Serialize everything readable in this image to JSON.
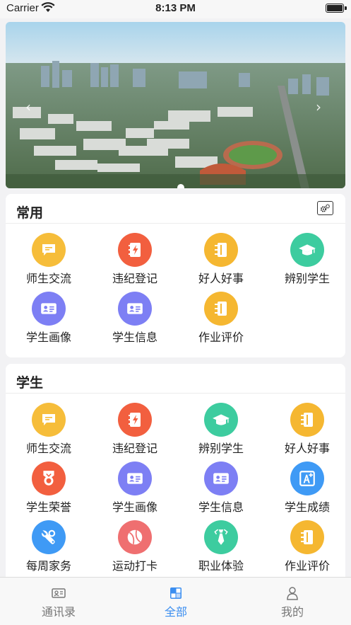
{
  "status_bar": {
    "carrier": "Carrier",
    "time": "8:13 PM"
  },
  "banner": {
    "slide_count": 1,
    "active_slide": 1
  },
  "common": {
    "title": "常用",
    "items": [
      {
        "label": "师生交流",
        "icon": "chat-icon",
        "color": "#f6bd3a"
      },
      {
        "label": "违纪登记",
        "icon": "lightning-notebook-icon",
        "color": "#f25f3f"
      },
      {
        "label": "好人好事",
        "icon": "notebook-icon",
        "color": "#f5b731"
      },
      {
        "label": "辨别学生",
        "icon": "graduation-cap-icon",
        "color": "#3dcc9f"
      },
      {
        "label": "学生画像",
        "icon": "id-card-icon",
        "color": "#7d7ff4"
      },
      {
        "label": "学生信息",
        "icon": "id-card-icon",
        "color": "#7d7ff4"
      },
      {
        "label": "作业评价",
        "icon": "notebook-icon",
        "color": "#f5b731"
      }
    ]
  },
  "student": {
    "title": "学生",
    "items": [
      {
        "label": "师生交流",
        "icon": "chat-icon",
        "color": "#f6bd3a"
      },
      {
        "label": "违纪登记",
        "icon": "lightning-notebook-icon",
        "color": "#f25f3f"
      },
      {
        "label": "辨别学生",
        "icon": "graduation-cap-icon",
        "color": "#3dcc9f"
      },
      {
        "label": "好人好事",
        "icon": "notebook-icon",
        "color": "#f5b731"
      },
      {
        "label": "学生荣誉",
        "icon": "medal-icon",
        "color": "#f25f3f"
      },
      {
        "label": "学生画像",
        "icon": "id-card-icon",
        "color": "#7d7ff4"
      },
      {
        "label": "学生信息",
        "icon": "id-card-icon",
        "color": "#7d7ff4"
      },
      {
        "label": "学生成绩",
        "icon": "grade-a-plus-icon",
        "color": "#3f9af5"
      },
      {
        "label": "每周家务",
        "icon": "wrench-icon",
        "color": "#3f9af5"
      },
      {
        "label": "运动打卡",
        "icon": "ball-icon",
        "color": "#ef6f70"
      },
      {
        "label": "职业体验",
        "icon": "tie-icon",
        "color": "#3dcc9f"
      },
      {
        "label": "作业评价",
        "icon": "notebook-icon",
        "color": "#f5b731"
      }
    ]
  },
  "tab_bar": {
    "tabs": [
      {
        "label": "通讯录",
        "icon": "contacts-icon",
        "active": false
      },
      {
        "label": "全部",
        "icon": "grid-icon",
        "active": true
      },
      {
        "label": "我的",
        "icon": "user-icon",
        "active": false
      }
    ],
    "active_color": "#3b8ef0",
    "inactive_color": "#777777"
  }
}
